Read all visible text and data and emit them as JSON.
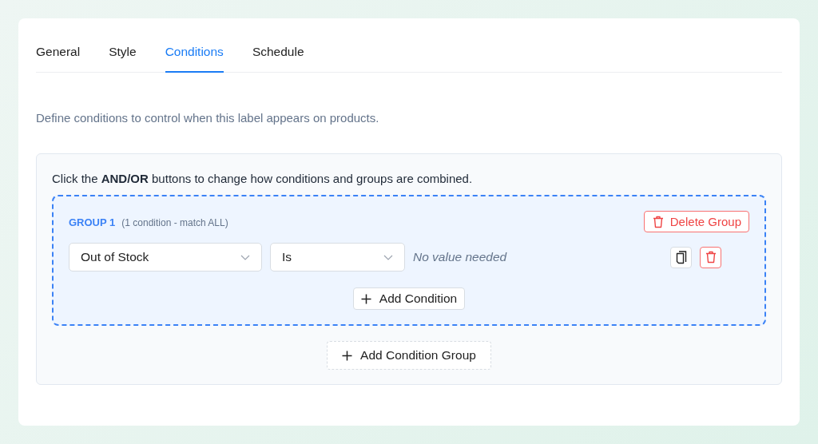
{
  "tabs": [
    {
      "label": "General",
      "selected": false
    },
    {
      "label": "Style",
      "selected": false
    },
    {
      "label": "Conditions",
      "selected": true
    },
    {
      "label": "Schedule",
      "selected": false
    }
  ],
  "description": "Define conditions to control when this label appears on products.",
  "panel": {
    "intro": "Click the **AND/OR** buttons to change how conditions and groups are combined.",
    "groups": [
      {
        "title": "GROUP 1",
        "summary": "(1 condition - match ALL)",
        "delete_button": "Delete Group",
        "conditions": [
          {
            "field": "Out of Stock",
            "operator": "Is",
            "value_hint": "No value needed"
          }
        ],
        "add_condition": "Add Condition"
      }
    ],
    "add_group": "Add Condition Group"
  }
}
